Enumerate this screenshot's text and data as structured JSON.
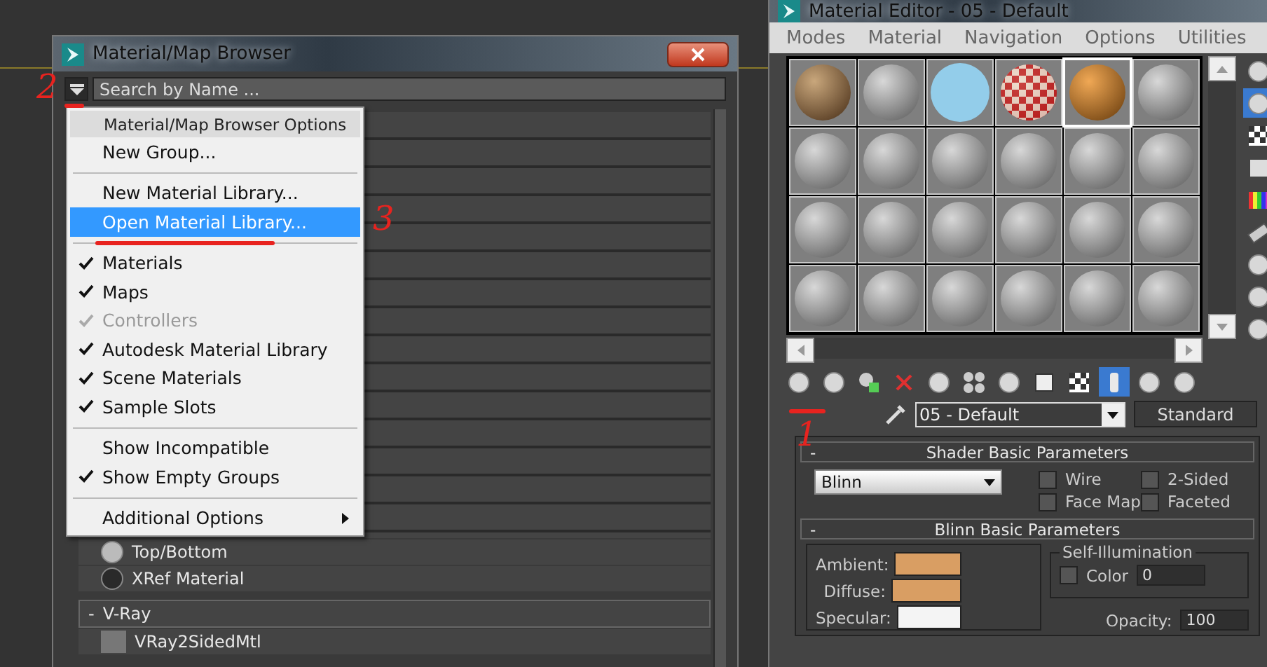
{
  "browser": {
    "title": "Material/Map Browser",
    "search": {
      "placeholder": "Search by Name ..."
    },
    "menu": [
      {
        "kind": "header",
        "label": "Material/Map Browser Options"
      },
      {
        "kind": "item",
        "label": "New Group...",
        "checked": false,
        "disabled": false,
        "selected": false
      },
      {
        "kind": "separator"
      },
      {
        "kind": "item",
        "label": "New Material Library...",
        "checked": false,
        "disabled": false,
        "selected": false
      },
      {
        "kind": "item",
        "label": "Open Material Library...",
        "checked": false,
        "disabled": false,
        "selected": true
      },
      {
        "kind": "separator"
      },
      {
        "kind": "item",
        "label": "Materials",
        "checked": true,
        "disabled": false,
        "selected": false
      },
      {
        "kind": "item",
        "label": "Maps",
        "checked": true,
        "disabled": false,
        "selected": false
      },
      {
        "kind": "item",
        "label": "Controllers",
        "checked": true,
        "disabled": true,
        "selected": false
      },
      {
        "kind": "item",
        "label": "Autodesk Material Library",
        "checked": true,
        "disabled": false,
        "selected": false
      },
      {
        "kind": "item",
        "label": "Scene Materials",
        "checked": true,
        "disabled": false,
        "selected": false
      },
      {
        "kind": "item",
        "label": "Sample Slots",
        "checked": true,
        "disabled": false,
        "selected": false
      },
      {
        "kind": "separator"
      },
      {
        "kind": "item",
        "label": "Show Incompatible",
        "checked": false,
        "disabled": false,
        "selected": false
      },
      {
        "kind": "item",
        "label": "Show Empty Groups",
        "checked": true,
        "disabled": false,
        "selected": false
      },
      {
        "kind": "separator"
      },
      {
        "kind": "submenu",
        "label": "Additional Options",
        "checked": false,
        "disabled": false,
        "selected": false
      }
    ],
    "list": [
      {
        "kind": "sphere",
        "label": "Top/Bottom"
      },
      {
        "kind": "dark-sphere",
        "label": "XRef Material"
      },
      {
        "kind": "group",
        "toggle": "-",
        "label": "V-Ray"
      },
      {
        "kind": "swatch",
        "label": "VRay2SidedMtl"
      }
    ]
  },
  "editor": {
    "title": "Material Editor - 05 - Default",
    "menus": [
      "Modes",
      "Material",
      "Navigation",
      "Options",
      "Utilities"
    ],
    "slots": [
      {
        "kind": "wood",
        "selected": false
      },
      {
        "kind": "grey",
        "selected": false
      },
      {
        "kind": "flat",
        "selected": false
      },
      {
        "kind": "checker",
        "selected": false
      },
      {
        "kind": "orange",
        "selected": true
      },
      {
        "kind": "grey",
        "selected": false
      },
      {
        "kind": "grey",
        "selected": false
      },
      {
        "kind": "grey",
        "selected": false
      },
      {
        "kind": "grey",
        "selected": false
      },
      {
        "kind": "grey",
        "selected": false
      },
      {
        "kind": "grey",
        "selected": false
      },
      {
        "kind": "grey",
        "selected": false
      },
      {
        "kind": "grey",
        "selected": false
      },
      {
        "kind": "grey",
        "selected": false
      },
      {
        "kind": "grey",
        "selected": false
      },
      {
        "kind": "grey",
        "selected": false
      },
      {
        "kind": "grey",
        "selected": false
      },
      {
        "kind": "grey",
        "selected": false
      },
      {
        "kind": "grey",
        "selected": false
      },
      {
        "kind": "grey",
        "selected": false
      },
      {
        "kind": "grey",
        "selected": false
      },
      {
        "kind": "grey",
        "selected": false
      },
      {
        "kind": "grey",
        "selected": false
      },
      {
        "kind": "grey",
        "selected": false
      }
    ],
    "side_tools": [
      {
        "kind": "sphere",
        "selected": false
      },
      {
        "kind": "sphere",
        "selected": true
      },
      {
        "kind": "checker",
        "selected": false
      },
      {
        "kind": "square",
        "selected": false
      },
      {
        "kind": "bars",
        "selected": false
      },
      {
        "kind": "film",
        "selected": false
      },
      {
        "kind": "sphere",
        "selected": false
      },
      {
        "kind": "sphere",
        "selected": false
      },
      {
        "kind": "sphere",
        "selected": false
      }
    ],
    "toolbar": [
      {
        "kind": "sphere",
        "selected": false
      },
      {
        "kind": "sphere",
        "selected": false
      },
      {
        "kind": "copy",
        "selected": false
      },
      {
        "kind": "delete",
        "selected": false
      },
      {
        "kind": "sphere",
        "selected": false
      },
      {
        "kind": "spheres",
        "selected": false
      },
      {
        "kind": "sphere",
        "selected": false
      },
      {
        "kind": "box",
        "selected": false
      },
      {
        "kind": "checker",
        "selected": false
      },
      {
        "kind": "cylinder",
        "selected": true
      },
      {
        "kind": "sphere",
        "selected": false
      },
      {
        "kind": "sphere",
        "selected": false
      }
    ],
    "material_name": "05 - Default",
    "material_type": "Standard",
    "shader": {
      "toggle": "-",
      "title": "Shader Basic Parameters",
      "type": "Blinn",
      "options": [
        {
          "label": "Wire",
          "checked": false
        },
        {
          "label": "2-Sided",
          "checked": false
        },
        {
          "label": "Face Map",
          "checked": false
        },
        {
          "label": "Faceted",
          "checked": false
        }
      ]
    },
    "basic": {
      "toggle": "-",
      "title": "Blinn Basic Parameters",
      "colors": [
        {
          "label": "Ambient:",
          "color": "#d99e63"
        },
        {
          "label": "Diffuse:",
          "color": "#d99e63"
        },
        {
          "label": "Specular:",
          "color": "#f4f4f4"
        }
      ],
      "self_illumination": {
        "title": "Self-Illumination",
        "label": "Color",
        "checked": false,
        "value": "0"
      },
      "opacity": {
        "label": "Opacity:",
        "value": "100"
      }
    }
  },
  "annotations": [
    {
      "text": "2"
    },
    {
      "text": "3"
    },
    {
      "text": "1"
    }
  ]
}
